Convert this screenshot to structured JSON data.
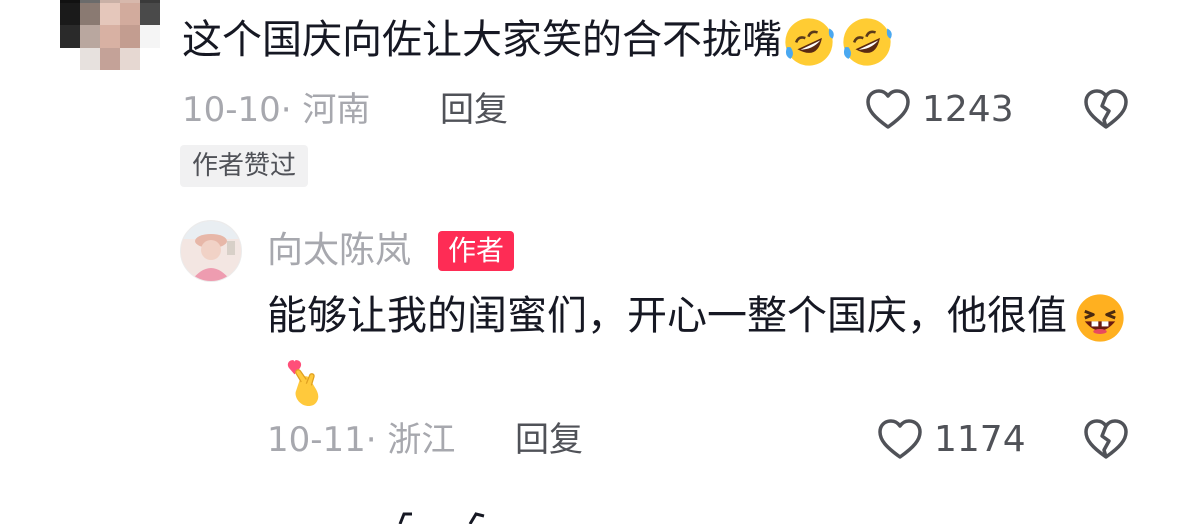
{
  "comment": {
    "text": "这个国庆向佐让大家笑的合不拢嘴",
    "emojis": [
      "rofl-emoji",
      "rofl-emoji"
    ],
    "date": "10-10",
    "location": "河南",
    "reply_label": "回复",
    "like_count": "1243",
    "liked_by_author_label": "作者赞过"
  },
  "reply": {
    "username": "向太陈岚",
    "badge": "作者",
    "text": "能够让我的闺蜜们，开心一整个国庆，他很值",
    "emojis": [
      "laughing-emoji",
      "finger-heart-emoji"
    ],
    "date": "10-11",
    "location": "浙江",
    "reply_label": "回复",
    "like_count": "1174"
  },
  "colors": {
    "text_primary": "#161823",
    "text_secondary": "#a7a8ae",
    "text_action": "#505258",
    "badge_bg": "#fe2c55",
    "tag_bg": "#f1f1f2"
  },
  "icons": {
    "like": "heart-outline-icon",
    "dislike": "broken-heart-icon"
  }
}
